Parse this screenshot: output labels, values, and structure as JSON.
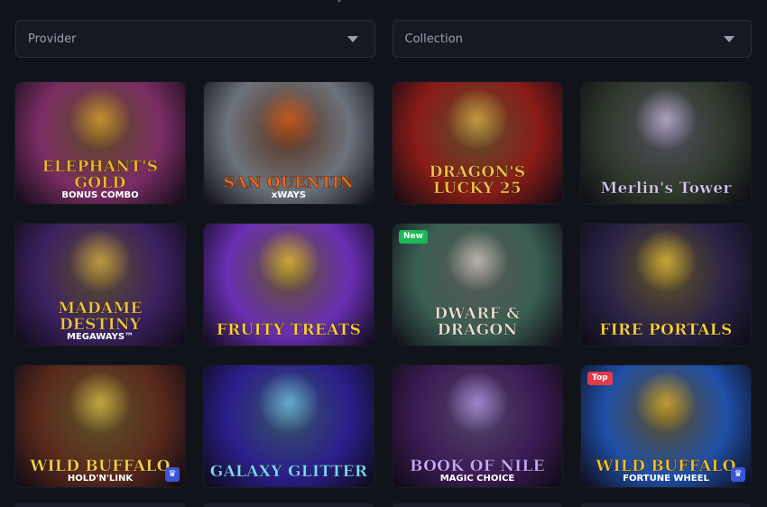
{
  "filters": {
    "provider_label": "Provider",
    "collection_label": "Collection"
  },
  "games": [
    {
      "title": "ELEPHANT'S GOLD",
      "subtitle": "BONUS COMBO",
      "badge": "",
      "bg": "#7a2d63",
      "accent": "#f3b531"
    },
    {
      "title": "SAN QUENTIN",
      "subtitle": "xWAYS",
      "badge": "",
      "bg": "#6c737c",
      "accent": "#f06a1d"
    },
    {
      "title": "DRAGON'S LUCKY 25",
      "subtitle": "",
      "badge": "",
      "bg": "#8a1c17",
      "accent": "#f2c24a"
    },
    {
      "title": "Merlin's Tower",
      "subtitle": "",
      "badge": "",
      "bg": "#2f3a2b",
      "accent": "#d9c9f2"
    },
    {
      "title": "MADAME DESTINY",
      "subtitle": "MEGAWAYS™",
      "badge": "",
      "bg": "#3b2160",
      "accent": "#f2c24a"
    },
    {
      "title": "FRUITY TREATS",
      "subtitle": "",
      "badge": "",
      "bg": "#6a2fb3",
      "accent": "#ffd23b"
    },
    {
      "title": "DWARF & DRAGON",
      "subtitle": "",
      "badge": "New",
      "bg": "#3a5e52",
      "accent": "#e8e0d0"
    },
    {
      "title": "FIRE PORTALS",
      "subtitle": "",
      "badge": "",
      "bg": "#2b2345",
      "accent": "#ffd23b"
    },
    {
      "title": "WILD BUFFALO",
      "subtitle": "HOLD'N'LINK",
      "badge": "",
      "bg": "#5a2a1c",
      "accent": "#f5d24a"
    },
    {
      "title": "GALAXY GLITTER",
      "subtitle": "",
      "badge": "",
      "bg": "#2b1e8a",
      "accent": "#7fd8ff"
    },
    {
      "title": "BOOK OF NILE",
      "subtitle": "MAGIC CHOICE",
      "badge": "",
      "bg": "#3c1b54",
      "accent": "#c9a8ff"
    },
    {
      "title": "WILD BUFFALO",
      "subtitle": "FORTUNE WHEEL",
      "badge": "Top",
      "bg": "#1f4fa8",
      "accent": "#f5c12e"
    }
  ]
}
